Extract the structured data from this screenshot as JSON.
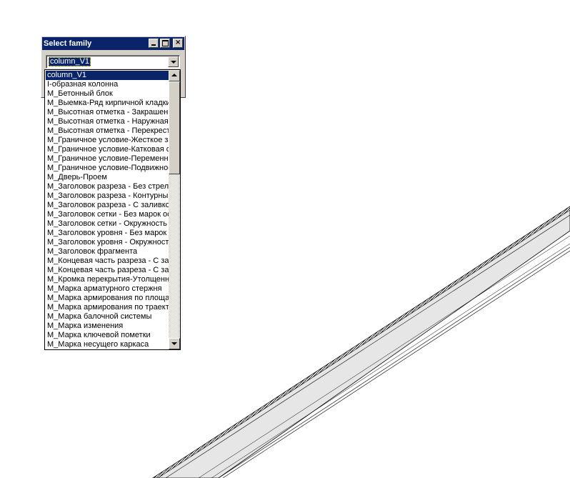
{
  "dialog": {
    "title": "Select family",
    "combo_value": "column_V1"
  },
  "dropdown": {
    "items": [
      "column_V1",
      "I-образная колонна",
      "M_Бетонный блок",
      "M_Выемка-Ряд кирпичной кладки",
      "M_Высотная отметка - Закрашенная",
      "M_Высотная отметка - Наружная",
      "M_Высотная отметка - Перекрестие",
      "M_Граничное условие-Жесткое защемление",
      "M_Граничное условие-Катковая опора",
      "M_Граничное условие-Переменное",
      "M_Граничное условие-Подвижное",
      "M_Дверь-Проем",
      "M_Заголовок разреза - Без стрелки",
      "M_Заголовок разреза - Контурный",
      "M_Заголовок разреза - С заливкой",
      "M_Заголовок сетки - Без марок осей",
      "M_Заголовок сетки - Окружность",
      "M_Заголовок уровня - Без марок",
      "M_Заголовок уровня - Окружность",
      "M_Заголовок фрагмента",
      "M_Концевая часть разреза - С заливкой",
      "M_Концевая часть разреза - С засечкой",
      "M_Кромка перекрытия-Утолщенная",
      "M_Марка арматурного стержня",
      "M_Марка армирования по площади",
      "M_Марка армирования по траектории",
      "M_Марка балочной системы",
      "M_Марка изменения",
      "M_Марка ключевой пометки",
      "M_Марка несущего каркаса"
    ],
    "selected_index": 0,
    "scroll_position": 0.0
  },
  "colors": {
    "titlebar": "#0a246a",
    "selection": "#0a246a",
    "face": "#d4d0c8",
    "beam_fill": "#e8e8e8",
    "beam_stroke": "#000000"
  },
  "icons": {
    "minimize": "minimize-icon",
    "maximize": "maximize-icon",
    "close": "close-icon",
    "dropdown_arrow": "chevron-down-icon",
    "scroll_up": "arrow-up-icon",
    "scroll_down": "arrow-down-icon"
  }
}
